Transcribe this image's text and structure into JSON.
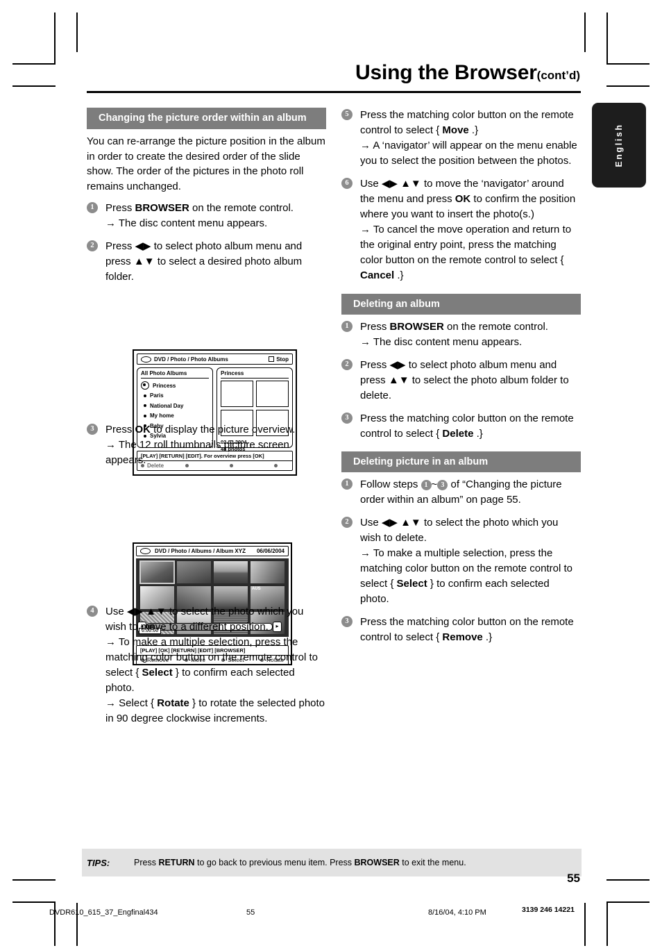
{
  "header": {
    "title": "Using the Browser",
    "title_suffix": "(cont’d)"
  },
  "side_tab": {
    "label": "English"
  },
  "left_column": {
    "section1": {
      "heading": "Changing the picture order within an album",
      "intro": "You can re-arrange the picture position in the album in order to create the desired order of the slide show.  The order of the pictures in the photo roll remains unchanged.",
      "steps": [
        {
          "num": "1",
          "text_1": "Press ",
          "bold_1": "BROWSER",
          "text_2": " on the remote control.",
          "arrow_1": "→ The disc content menu appears."
        },
        {
          "num": "2",
          "text_1": "Press ◀▶ to select photo album menu and press ▲▼ to select a desired photo album folder."
        },
        {
          "num": "3",
          "text_1": "Press ",
          "bold_1": "OK",
          "text_2": " to display the picture overview.",
          "arrow_1": "→ The 12 roll thumbnails picture screen appears."
        },
        {
          "num": "4",
          "text_1": "Use ◀▶ ▲▼  to select the photo which you wish to move to a different position.",
          "arrow_1_a": "→ To make a multiple selection, press the matching color button on the remote control to select { ",
          "arrow_1_bold": "Select",
          "arrow_1_b": " } to confirm each selected photo.",
          "arrow_2_a": "→ Select { ",
          "arrow_2_bold": "Rotate",
          "arrow_2_b": " } to rotate the selected photo in 90 degree clockwise increments."
        }
      ]
    }
  },
  "right_column": {
    "steps_continued": [
      {
        "num": "5",
        "text_1": "Press the matching color button on the remote control to select { ",
        "bold_1": "Move",
        "text_2": " .}",
        "arrow_1": "→ A ‘navigator’ will appear on the menu enable you to select the position between the photos."
      },
      {
        "num": "6",
        "text_1": "Use ◀▶ ▲▼  to move the ‘navigator’ around the menu and press ",
        "bold_1": "OK",
        "text_2": " to confirm the position where you want to insert the photo(s.)",
        "arrow_1_a": "→ To cancel the move operation and return to the original entry point, press the matching color button on the remote control to select { ",
        "arrow_1_bold": "Cancel",
        "arrow_1_b": " .}"
      }
    ],
    "section2": {
      "heading": "Deleting an album",
      "steps": [
        {
          "num": "1",
          "text_1": "Press ",
          "bold_1": "BROWSER",
          "text_2": " on the remote control.",
          "arrow_1": "→ The disc content menu appears."
        },
        {
          "num": "2",
          "text_1": "Press ◀▶ to select photo album menu and press ▲▼ to select the photo album folder to delete."
        },
        {
          "num": "3",
          "text_1": "Press the matching color button on the remote control to select { ",
          "bold_1": "Delete",
          "text_2": " .}"
        }
      ]
    },
    "section3": {
      "heading": "Deleting picture in an album",
      "steps": [
        {
          "num": "1",
          "text_a": "Follow steps ",
          "inline_num_1": "1",
          "text_b": "~",
          "inline_num_2": "3",
          "text_c": " of “Changing the picture order within an album” on page 55."
        },
        {
          "num": "2",
          "text_1": "Use ◀▶ ▲▼  to select the photo which you wish to delete.",
          "arrow_1_a": "→ To make a multiple selection, press the matching color button on the remote control to select { ",
          "arrow_1_bold": "Select",
          "arrow_1_b": " } to confirm each selected photo."
        },
        {
          "num": "3",
          "text_1": "Press the matching color button on the remote control to select { ",
          "bold_1": "Remove",
          "text_2": " .}"
        }
      ]
    }
  },
  "tv_albums_screen": {
    "breadcrumb": "DVD / Photo / Photo Albums",
    "status": "Stop",
    "left_panel_title": "All Photo Albums",
    "albums": [
      {
        "label": "Princess",
        "selected": true
      },
      {
        "label": "Paris",
        "selected": false
      },
      {
        "label": "National Day",
        "selected": false
      },
      {
        "label": "My home",
        "selected": false
      },
      {
        "label": "Baby",
        "selected": false
      },
      {
        "label": "Sylvia",
        "selected": false
      }
    ],
    "right_panel_title": "Princess",
    "meta_date": "02.03.2004",
    "meta_count": "48 photos",
    "hint_line": "[PLAY] [RETURN] [EDIT].  For overview press [OK]",
    "color_buttons": [
      "Delete",
      "",
      "",
      ""
    ]
  },
  "tv_overview_screen": {
    "breadcrumb": "DVD / Photo / Albums / Album XYZ",
    "date": "06/06/2004",
    "thumbnail_count": 12,
    "thumbnail_label": "AUS",
    "timecode": "0:00:00",
    "hint_line": "[PLAY] [OK] [RETURN] [EDIT] [BROWSER]",
    "color_buttons": [
      "Remove",
      "Move",
      "Select",
      "Rotate"
    ]
  },
  "tips": {
    "label": "TIPS:",
    "text_a": "Press ",
    "bold_a": "RETURN",
    "text_b": " to go back to previous menu item.  Press ",
    "bold_b": "BROWSER",
    "text_c": " to exit the menu."
  },
  "page_number": "55",
  "footer": {
    "file": "DVDR610_615_37_Engfinal434",
    "page": "55",
    "timestamp": "8/16/04, 4:10 PM",
    "code": "3139 246 14221"
  },
  "colors": {
    "section_bar": "#7d7d7d",
    "step_badge": "#8c8c8c",
    "tips_bg": "#e2e2e2",
    "tab_bg": "#1d1d1d"
  }
}
